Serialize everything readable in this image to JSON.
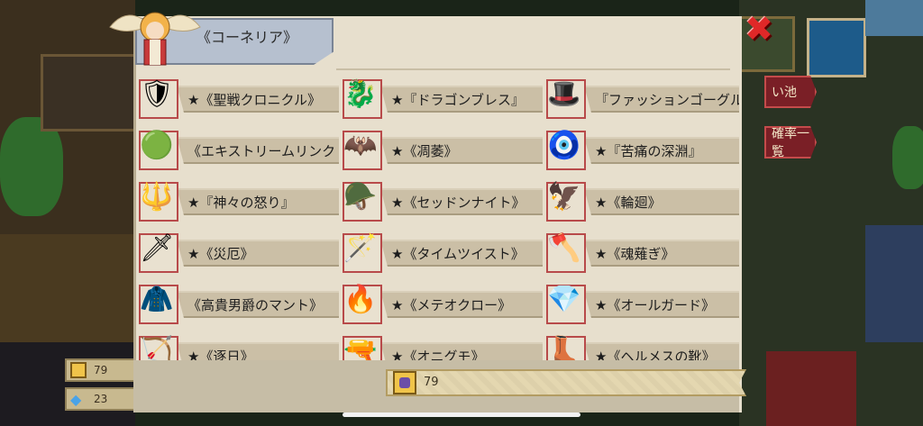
{
  "window": {
    "title": "《コーネリア》"
  },
  "header": {
    "title_visible": "《コーネリア》"
  },
  "side_buttons": [
    {
      "label": "い池"
    },
    {
      "label": "確率一覧"
    }
  ],
  "currency_left": [
    {
      "value": "79",
      "icon": "hero-token-icon"
    },
    {
      "value": "23",
      "icon": "gem-icon"
    }
  ],
  "footer": {
    "value": "79",
    "icon": "hero-token-icon"
  },
  "items": [
    {
      "label": "★《聖戦クロニクル》",
      "icon": "armor-icon",
      "glyph": "🛡"
    },
    {
      "label": "★『ドラゴンブレス』",
      "icon": "dragon-helmet-icon",
      "glyph": "🐉"
    },
    {
      "label": "『ファッションゴーグル",
      "icon": "goggle-hat-icon",
      "glyph": "🎩"
    },
    {
      "label": "《エキストリームリンク",
      "icon": "device-icon",
      "glyph": "🟢"
    },
    {
      "label": "★《凋萎》",
      "icon": "dark-armor-icon",
      "glyph": "🦇"
    },
    {
      "label": "★『苦痛の深淵』",
      "icon": "amulet-icon",
      "glyph": "🧿"
    },
    {
      "label": "★『神々の怒り』",
      "icon": "spear-icon",
      "glyph": "🔱"
    },
    {
      "label": "★《セッドンナイト》",
      "icon": "blue-helmet-icon",
      "glyph": "🪖"
    },
    {
      "label": "★《輪廻》",
      "icon": "claw-icon",
      "glyph": "🦅"
    },
    {
      "label": "★《災厄》",
      "icon": "sword-icon",
      "glyph": "🗡"
    },
    {
      "label": "★《タイムツイスト》",
      "icon": "staff-icon",
      "glyph": "🪄"
    },
    {
      "label": "★《魂薙ぎ》",
      "icon": "axe-icon",
      "glyph": "🪓"
    },
    {
      "label": "《高貴男爵のマント》",
      "icon": "cape-icon",
      "glyph": "🧥"
    },
    {
      "label": "★《メテオクロー》",
      "icon": "meteor-claw-icon",
      "glyph": "🔥"
    },
    {
      "label": "★《オールガード》",
      "icon": "guard-gem-icon",
      "glyph": "💎"
    },
    {
      "label": "★《逐日》",
      "icon": "bow-icon",
      "glyph": "🏹"
    },
    {
      "label": "★《オニグモ》",
      "icon": "gun-icon",
      "glyph": "🔫"
    },
    {
      "label": "★《ヘルメスの靴》",
      "icon": "boots-icon",
      "glyph": "👢"
    }
  ],
  "colors": {
    "panel": "#e7dfcd",
    "label_bg": "#cbbfa6",
    "icon_border": "#b84a4a",
    "close": "#e02828"
  }
}
